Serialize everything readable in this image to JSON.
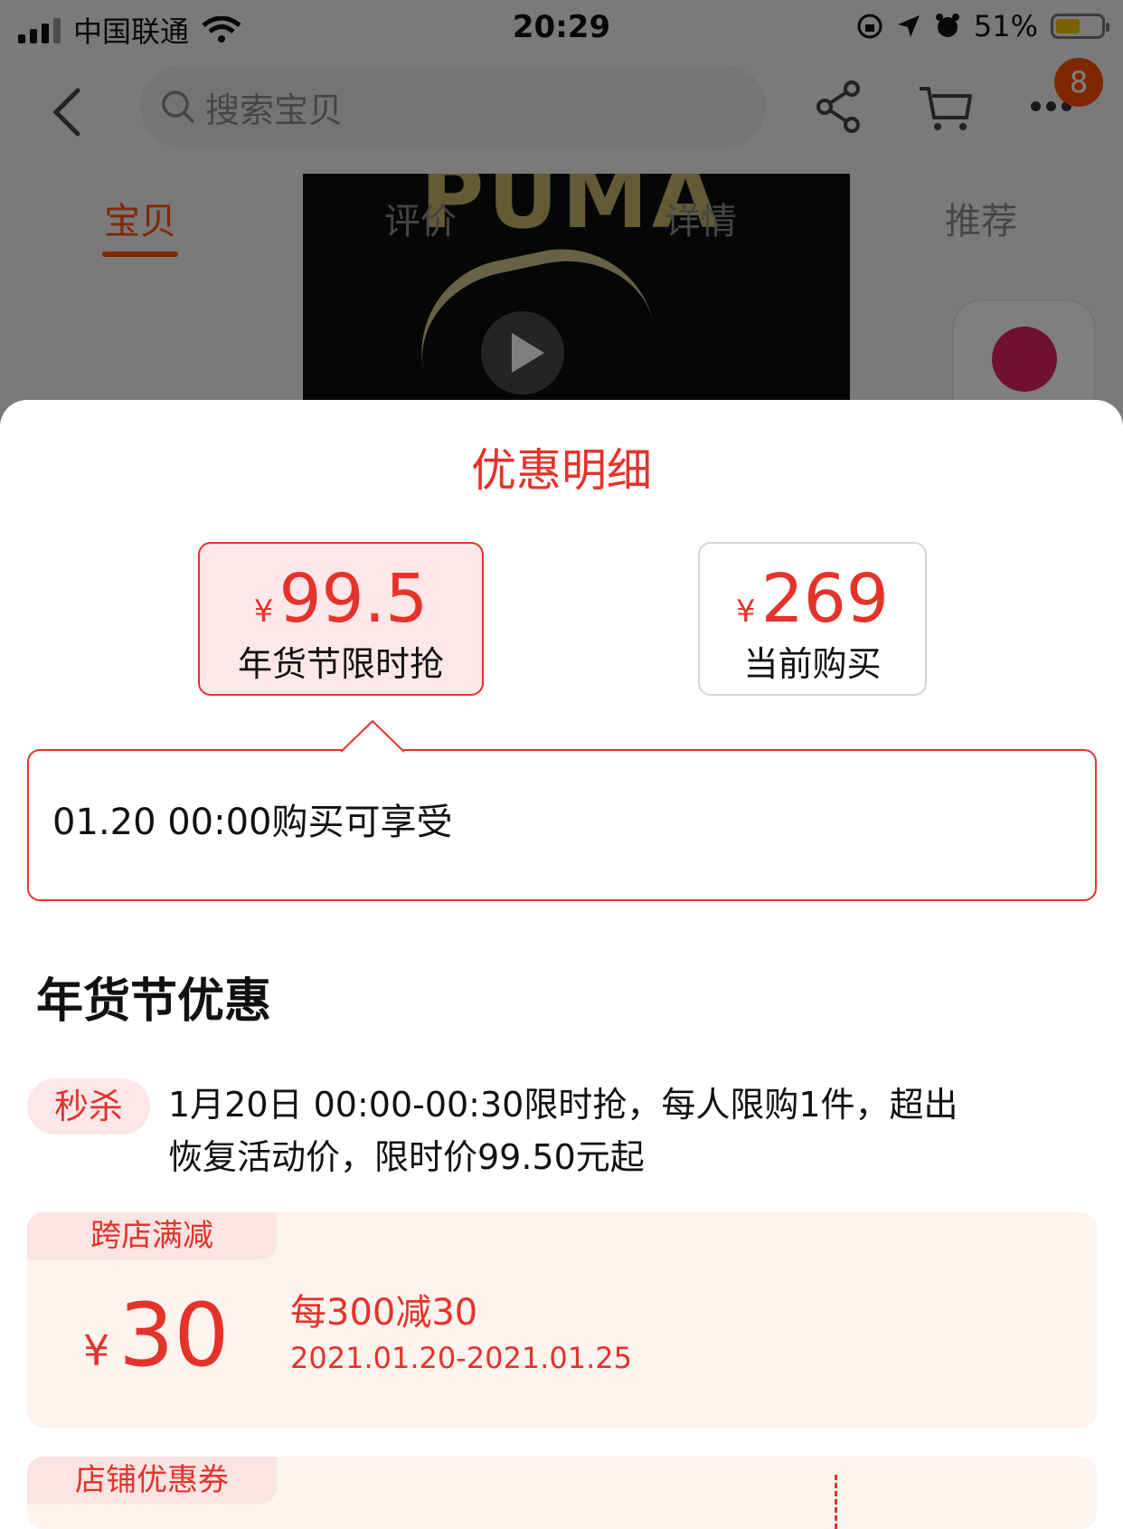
{
  "status_bar": {
    "carrier": "中国联通",
    "time": "20:29",
    "battery_percent": "51%"
  },
  "nav": {
    "search_placeholder": "搜索宝贝",
    "cart_badge": "8",
    "icons": [
      "back-icon",
      "search-icon",
      "share-icon",
      "cart-icon",
      "more-icon"
    ]
  },
  "product_image": {
    "brand_text": "PUMA"
  },
  "tabs": [
    {
      "label": "宝贝",
      "active": true
    },
    {
      "label": "评价",
      "active": false
    },
    {
      "label": "详情",
      "active": false
    },
    {
      "label": "推荐",
      "active": false
    }
  ],
  "sheet": {
    "title": "优惠明细",
    "price_options": [
      {
        "currency": "¥",
        "price": "99.5",
        "label": "年货节限时抢",
        "selected": true
      },
      {
        "currency": "¥",
        "price": "269",
        "label": "当前购买",
        "selected": false
      }
    ],
    "tooltip": "01.20 00:00购买可享受",
    "section_title": "年货节优惠",
    "seckill": {
      "tag": "秒杀",
      "desc": "1月20日 00:00-00:30限时抢，每人限购1件，超出恢复活动价，限时价99.50元起"
    },
    "coupons": [
      {
        "tag": "跨店满减",
        "currency": "¥",
        "amount": "30",
        "rule": "每300减30",
        "date": "2021.01.20-2021.01.25"
      },
      {
        "tag": "店铺优惠券"
      }
    ]
  },
  "colors": {
    "accent_red": "#e5332a",
    "brand_orange": "#ff5000",
    "tag_bg": "#fde7e9",
    "coupon_bg": "#fdf3ef"
  }
}
